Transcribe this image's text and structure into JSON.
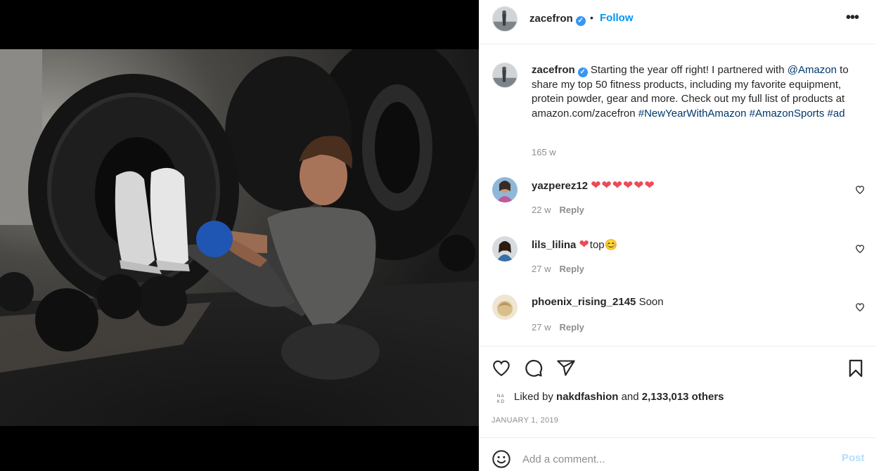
{
  "post": {
    "username": "zacefron",
    "verified_mark": "✓",
    "dot": "•",
    "follow_label": "Follow",
    "more_label": "•••",
    "caption": {
      "username": "zacefron",
      "text_1": "Starting the year off right! I partnered with ",
      "mention": "@Amazon",
      "text_2": " to share my top 50 fitness products, including my favorite equipment, protein powder, gear and more. Check out my full list of products at amazon.com/zacefron ",
      "hashtag_1": "#NewYearWithAmazon",
      "hashtag_2": "#AmazonSports",
      "hashtag_3": "#ad",
      "time": "165 w"
    },
    "comments": [
      {
        "username": "yazperez12",
        "text": "❤❤❤❤❤❤",
        "time": "22 w",
        "reply_label": "Reply"
      },
      {
        "username": "lils_lilina",
        "text_heart": "❤",
        "text": "top",
        "emoji": "😊",
        "time": "27 w",
        "reply_label": "Reply"
      },
      {
        "username": "phoenix_rising_2145",
        "text": "Soon",
        "time": "27 w",
        "reply_label": "Reply"
      }
    ],
    "likes": {
      "prefix": "Liked by ",
      "liker": "nakdfashion",
      "middle": " and ",
      "others": "2,133,013 others"
    },
    "date": "JANUARY 1, 2019",
    "add_comment": {
      "placeholder": "Add a comment...",
      "post_label": "Post"
    },
    "icons": {
      "like": "heart-outline-icon",
      "comment": "comment-bubble-icon",
      "share": "paper-plane-icon",
      "save": "bookmark-icon",
      "emoji": "smiley-icon",
      "more": "ellipsis-icon"
    },
    "colors": {
      "follow": "#0095f6",
      "link": "#00376b",
      "heart": "#ed4956",
      "post_disabled": "#b2dffc",
      "muted": "#8e8e8e"
    }
  }
}
